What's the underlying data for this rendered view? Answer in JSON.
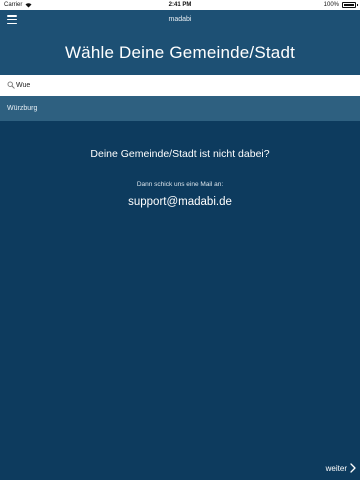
{
  "status_bar": {
    "carrier": "Carrier",
    "time": "2:41 PM",
    "battery": "100%",
    "battery_level": 1.0
  },
  "nav": {
    "title": "madabi",
    "menu_icon": "hamburger-menu-icon"
  },
  "header": {
    "title": "Wähle Deine Gemeinde/Stadt"
  },
  "search": {
    "value": "Wue",
    "icon": "search-icon"
  },
  "results": [
    {
      "label": "Würzburg"
    }
  ],
  "not_found": {
    "heading": "Deine Gemeinde/Stadt ist nicht dabei?",
    "hint": "Dann schick uns eine Mail an:",
    "email": "support@madabi.de"
  },
  "footer": {
    "next_label": "weiter",
    "next_icon": "chevron-right-icon"
  },
  "colors": {
    "background": "#0d3b5e",
    "header": "#1d5074",
    "result_row": "#2e6080",
    "text": "#ffffff"
  }
}
